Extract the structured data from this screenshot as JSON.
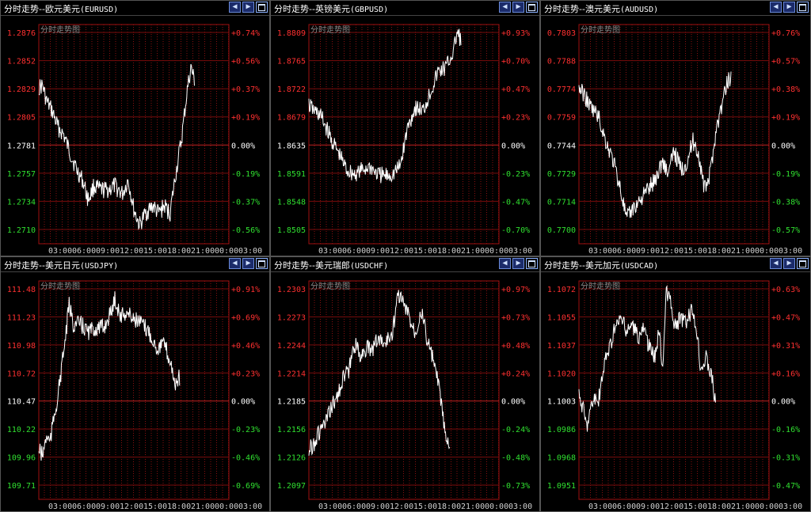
{
  "subtitle": "分时走势图",
  "time_labels": [
    "03:00",
    "06:00",
    "09:00",
    "12:00",
    "15:00",
    "18:00",
    "21:00",
    "00:00",
    "03:00"
  ],
  "colors": {
    "up": "#ff3030",
    "down": "#30e030",
    "flat": "#ffffff",
    "grid": "#8a1010",
    "line": "#ffffff"
  },
  "icons": {
    "prev": "arrow-left-icon",
    "next": "arrow-right-icon",
    "window": "window-icon"
  },
  "panels": [
    {
      "title": "分时走势--欧元美元",
      "symbol": "(EURUSD)",
      "prices": [
        "1.2876",
        "1.2852",
        "1.2829",
        "1.2805",
        "1.2781",
        "1.2757",
        "1.2734",
        "1.2710"
      ],
      "percents": [
        "+0.74%",
        "+0.56%",
        "+0.37%",
        "+0.19%",
        "0.00%",
        "-0.19%",
        "-0.37%",
        "-0.56%"
      ]
    },
    {
      "title": "分时走势--英镑美元",
      "symbol": "(GBPUSD)",
      "prices": [
        "1.8809",
        "1.8765",
        "1.8722",
        "1.8679",
        "1.8635",
        "1.8591",
        "1.8548",
        "1.8505"
      ],
      "percents": [
        "+0.93%",
        "+0.70%",
        "+0.47%",
        "+0.23%",
        "0.00%",
        "-0.23%",
        "-0.47%",
        "-0.70%"
      ]
    },
    {
      "title": "分时走势--澳元美元",
      "symbol": "(AUDUSD)",
      "prices": [
        "0.7803",
        "0.7788",
        "0.7774",
        "0.7759",
        "0.7744",
        "0.7729",
        "0.7714",
        "0.7700"
      ],
      "percents": [
        "+0.76%",
        "+0.57%",
        "+0.38%",
        "+0.19%",
        "0.00%",
        "-0.19%",
        "-0.38%",
        "-0.57%"
      ]
    },
    {
      "title": "分时走势--美元日元",
      "symbol": "(USDJPY)",
      "prices": [
        "111.48",
        "111.23",
        "110.98",
        "110.72",
        "110.47",
        "110.22",
        "109.96",
        "109.71"
      ],
      "percents": [
        "+0.91%",
        "+0.69%",
        "+0.46%",
        "+0.23%",
        "0.00%",
        "-0.23%",
        "-0.46%",
        "-0.69%"
      ]
    },
    {
      "title": "分时走势--美元瑞郎",
      "symbol": "(USDCHF)",
      "prices": [
        "1.2303",
        "1.2273",
        "1.2244",
        "1.2214",
        "1.2185",
        "1.2156",
        "1.2126",
        "1.2097"
      ],
      "percents": [
        "+0.97%",
        "+0.73%",
        "+0.48%",
        "+0.24%",
        "0.00%",
        "-0.24%",
        "-0.48%",
        "-0.73%"
      ]
    },
    {
      "title": "分时走势--美元加元",
      "symbol": "(USDCAD)",
      "prices": [
        "1.1072",
        "1.1055",
        "1.1037",
        "1.1020",
        "1.1003",
        "1.0986",
        "1.0968",
        "1.0951"
      ],
      "percents": [
        "+0.63%",
        "+0.47%",
        "+0.31%",
        "+0.16%",
        "0.00%",
        "-0.16%",
        "-0.31%",
        "-0.47%"
      ]
    }
  ]
}
